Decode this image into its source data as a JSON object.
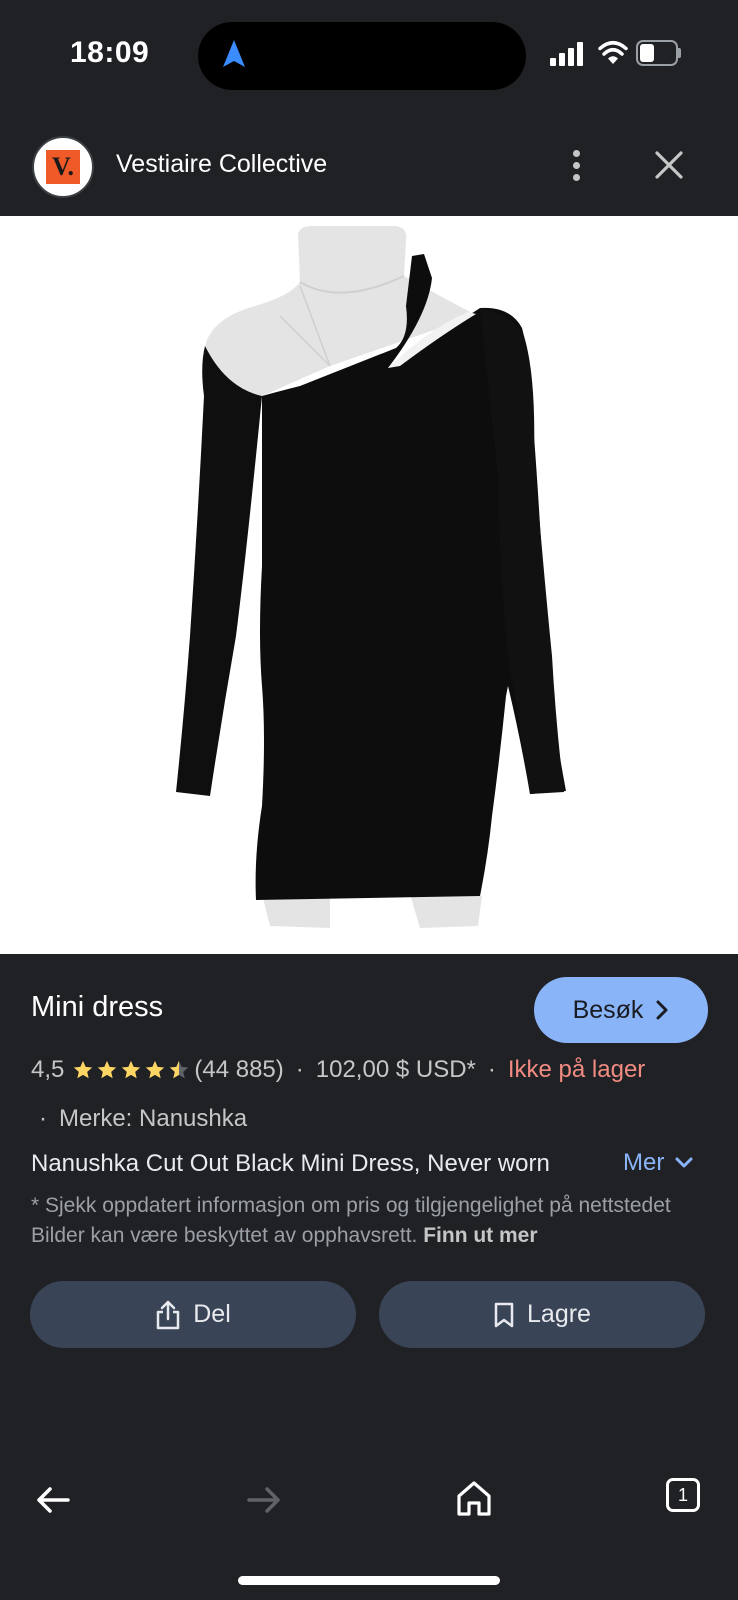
{
  "status_bar": {
    "time": "18:09"
  },
  "header": {
    "logo_letter": "V.",
    "site_name": "Vestiaire Collective"
  },
  "product": {
    "title": "Mini dress",
    "visit_label": "Besøk",
    "rating": "4,5",
    "rating_value": 4.5,
    "review_count": "(44 885)",
    "price": "102,00 $ USD*",
    "stock": "Ikke på lager",
    "brand": "Merke: Nanushka",
    "description": "Nanushka Cut Out Black Mini Dress, Never worn",
    "more_label": "Mer",
    "disclaimer": "* Sjekk oppdatert informasjon om pris og tilgjengelighet på nettstedet Bilder kan være beskyttet av opphavsrett.",
    "learn_more": "Finn ut mer"
  },
  "actions": {
    "share_label": "Del",
    "save_label": "Lagre"
  },
  "bottom_nav": {
    "tab_count": "1"
  },
  "colors": {
    "accent": "#8ab4f8",
    "stock_warning": "#f28b82",
    "background": "#202125",
    "button": "#394457",
    "star": "#fdd663"
  }
}
